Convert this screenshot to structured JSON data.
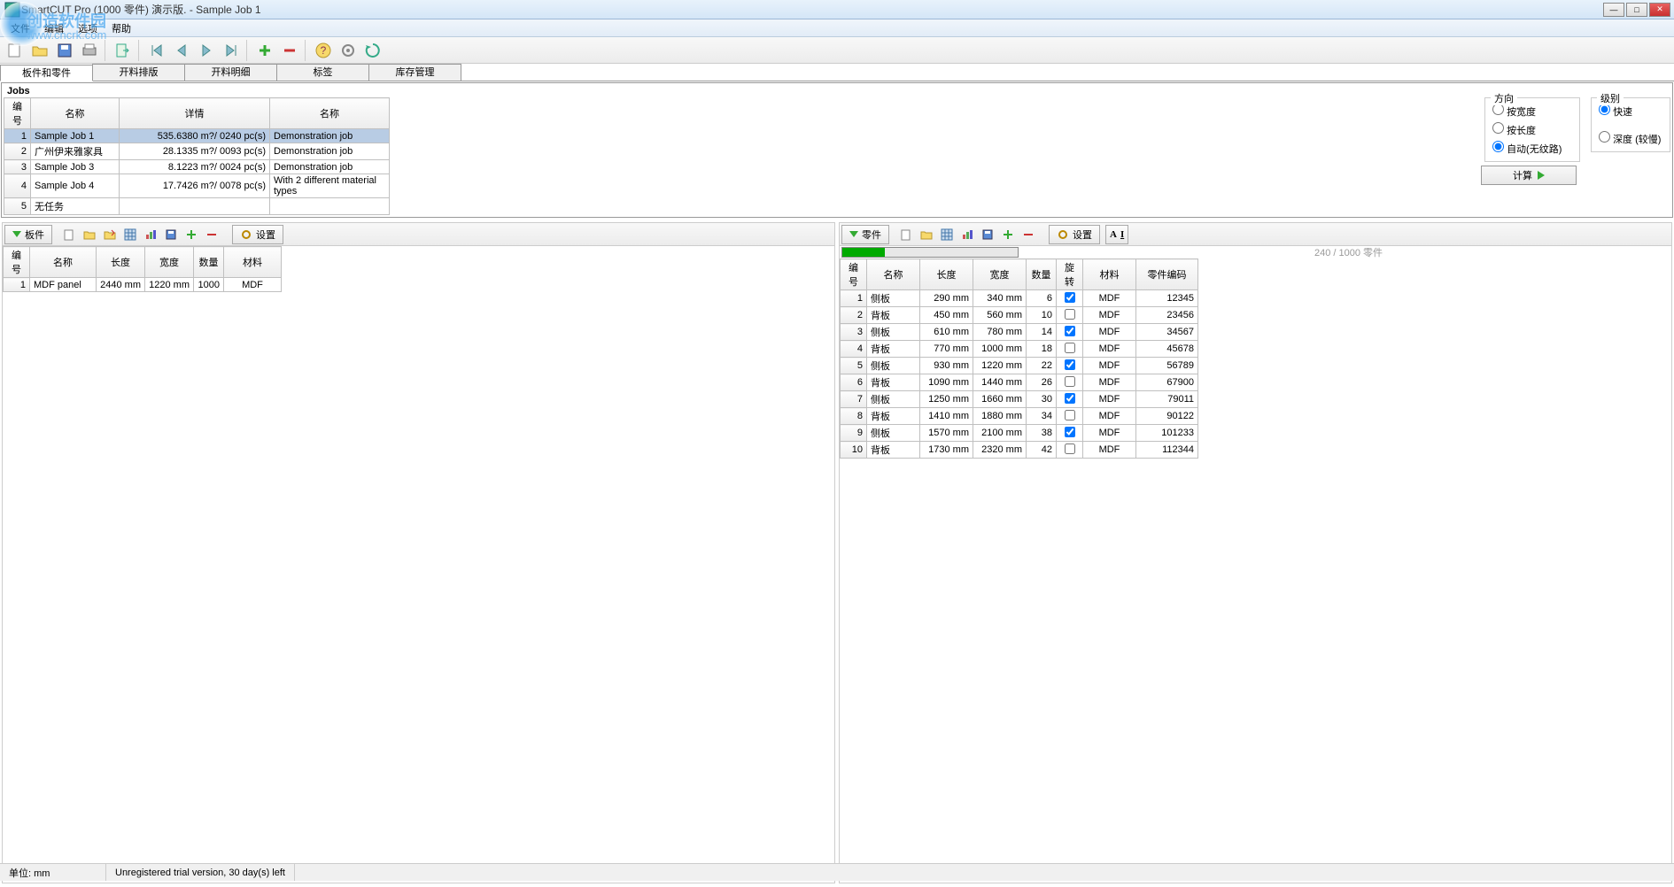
{
  "window": {
    "title": "SmartCUT Pro (1000 零件) 演示版. - Sample Job 1"
  },
  "watermark": {
    "name": "创造软件园",
    "url": "www.cncrk.com"
  },
  "menu": {
    "file": "文件",
    "edit": "编辑",
    "options": "选项",
    "help": "帮助"
  },
  "tabs": {
    "t1": "板件和零件",
    "t2": "开料排版",
    "t3": "开料明细",
    "t4": "标签",
    "t5": "库存管理"
  },
  "jobs": {
    "header": "Jobs",
    "cols": {
      "id": "编号",
      "name": "名称",
      "detail": "详情",
      "desc": "名称"
    },
    "rows": [
      {
        "id": "1",
        "name": "Sample Job 1",
        "detail": "535.6380 m?/ 0240 pc(s)",
        "desc": "Demonstration job"
      },
      {
        "id": "2",
        "name": "广州伊来雅家具",
        "detail": "28.1335 m?/ 0093 pc(s)",
        "desc": "Demonstration job"
      },
      {
        "id": "3",
        "name": "Sample Job 3",
        "detail": "8.1223 m?/ 0024 pc(s)",
        "desc": "Demonstration job"
      },
      {
        "id": "4",
        "name": "Sample Job 4",
        "detail": "17.7426 m?/ 0078 pc(s)",
        "desc": "With 2 different material types"
      },
      {
        "id": "5",
        "name": "无任务",
        "detail": "",
        "desc": ""
      }
    ]
  },
  "direction": {
    "legend": "方向",
    "opt1": "按宽度",
    "opt2": "按长度",
    "opt3": "自动(无纹路)",
    "selected": "opt3"
  },
  "level": {
    "legend": "级别",
    "opt1": "快速",
    "opt2": "深度 (较慢)",
    "selected": "opt1"
  },
  "calc_button": "计算",
  "panel_left": {
    "title": "板件",
    "settings": "设置",
    "cols": {
      "id": "编号",
      "name": "名称",
      "length": "长度",
      "width": "宽度",
      "qty": "数量",
      "material": "材料"
    },
    "rows": [
      {
        "id": "1",
        "name": "MDF panel",
        "length": "2440 mm",
        "width": "1220 mm",
        "qty": "1000",
        "material": "MDF"
      }
    ]
  },
  "panel_right": {
    "title": "零件",
    "settings": "设置",
    "progress_text": "240 / 1000 零件",
    "cols": {
      "id": "编号",
      "name": "名称",
      "length": "长度",
      "width": "宽度",
      "qty": "数量",
      "rotate": "旋转",
      "material": "材料",
      "code": "零件编码"
    },
    "rows": [
      {
        "id": "1",
        "name": "侧板",
        "length": "290 mm",
        "width": "340 mm",
        "qty": "6",
        "rotate": true,
        "material": "MDF",
        "code": "12345"
      },
      {
        "id": "2",
        "name": "背板",
        "length": "450 mm",
        "width": "560 mm",
        "qty": "10",
        "rotate": false,
        "material": "MDF",
        "code": "23456"
      },
      {
        "id": "3",
        "name": "侧板",
        "length": "610 mm",
        "width": "780 mm",
        "qty": "14",
        "rotate": true,
        "material": "MDF",
        "code": "34567"
      },
      {
        "id": "4",
        "name": "背板",
        "length": "770 mm",
        "width": "1000 mm",
        "qty": "18",
        "rotate": false,
        "material": "MDF",
        "code": "45678"
      },
      {
        "id": "5",
        "name": "侧板",
        "length": "930 mm",
        "width": "1220 mm",
        "qty": "22",
        "rotate": true,
        "material": "MDF",
        "code": "56789"
      },
      {
        "id": "6",
        "name": "背板",
        "length": "1090 mm",
        "width": "1440 mm",
        "qty": "26",
        "rotate": false,
        "material": "MDF",
        "code": "67900"
      },
      {
        "id": "7",
        "name": "侧板",
        "length": "1250 mm",
        "width": "1660 mm",
        "qty": "30",
        "rotate": true,
        "material": "MDF",
        "code": "79011"
      },
      {
        "id": "8",
        "name": "背板",
        "length": "1410 mm",
        "width": "1880 mm",
        "qty": "34",
        "rotate": false,
        "material": "MDF",
        "code": "90122"
      },
      {
        "id": "9",
        "name": "侧板",
        "length": "1570 mm",
        "width": "2100 mm",
        "qty": "38",
        "rotate": true,
        "material": "MDF",
        "code": "101233"
      },
      {
        "id": "10",
        "name": "背板",
        "length": "1730 mm",
        "width": "2320 mm",
        "qty": "42",
        "rotate": false,
        "material": "MDF",
        "code": "112344"
      }
    ]
  },
  "status": {
    "unit": "单位: mm",
    "trial": "Unregistered trial version, 30 day(s) left"
  }
}
